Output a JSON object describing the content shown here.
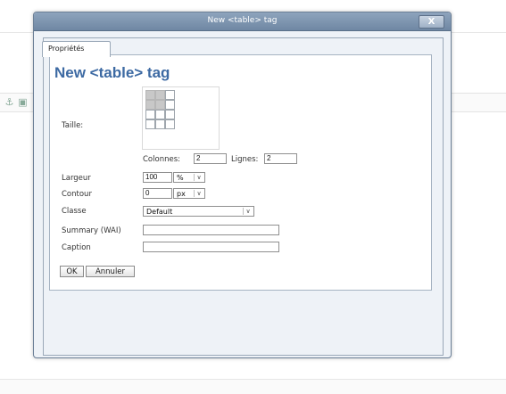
{
  "dialog": {
    "title": "New <table> tag",
    "close_label": "X",
    "tab_label": "Propriétés",
    "heading": "New <table> tag"
  },
  "form": {
    "taille_label": "Taille:",
    "columns_label": "Colonnes:",
    "columns_value": "2",
    "rows_label": "Lignes:",
    "rows_value": "2",
    "width_label": "Largeur",
    "width_value": "100",
    "width_unit": "%",
    "border_label": "Contour",
    "border_value": "0",
    "border_unit": "px",
    "class_label": "Classe",
    "class_value": "Default",
    "summary_label": "Summary (WAI)",
    "summary_value": "",
    "caption_label": "Caption",
    "caption_value": ""
  },
  "buttons": {
    "ok": "OK",
    "cancel": "Annuler"
  },
  "icons": {
    "close": "close-icon",
    "dropdown": "chevron-down-icon",
    "toolbar_anchor": "anchor-icon",
    "toolbar_image": "image-icon"
  },
  "table_size_picker": {
    "columns": 2,
    "rows": 2,
    "grid_columns": 3,
    "grid_rows": 4
  }
}
